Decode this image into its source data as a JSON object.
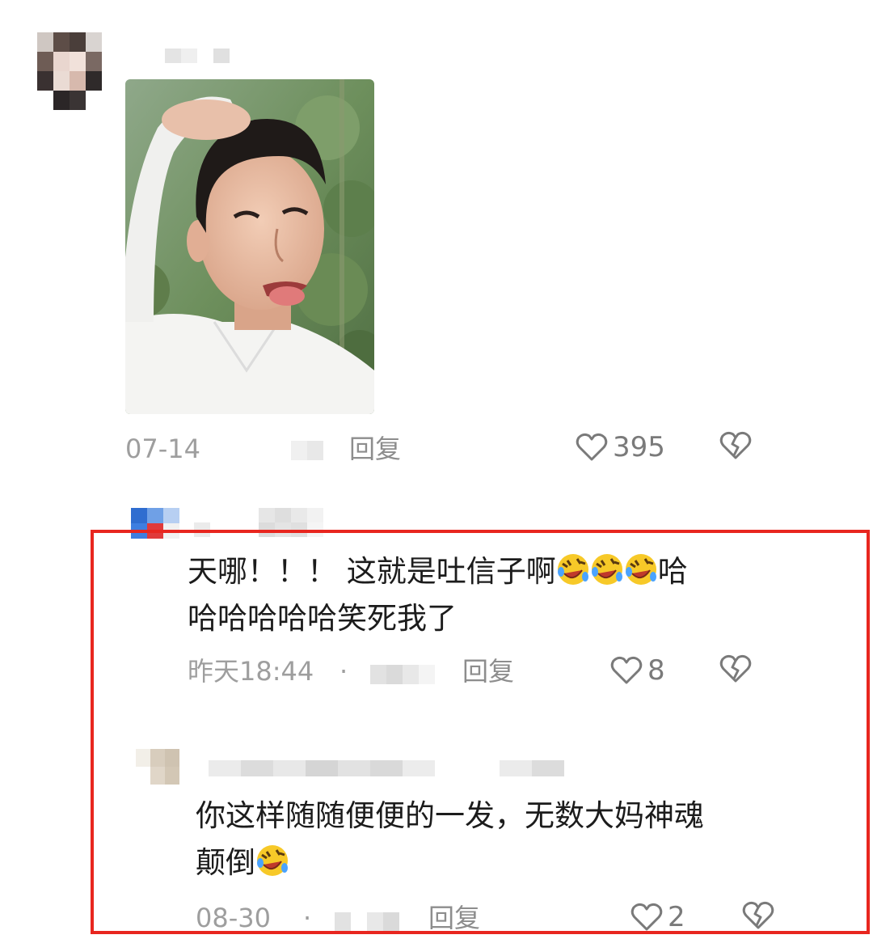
{
  "comments": [
    {
      "date": "07-14",
      "reply_label": "回复",
      "likes": "395",
      "has_image": true
    },
    {
      "text_line1": "天哪！！！ 这就是吐信子啊",
      "text_line1_tail": "哈",
      "text_line2": "哈哈哈哈哈笑死我了",
      "emoji_count_line1": 3,
      "date": "昨天18:44",
      "separator": "·",
      "reply_label": "回复",
      "likes": "8"
    },
    {
      "text_line1": "你这样随随便便的一发，无数大妈神魂",
      "text_line2": "颠倒",
      "date": "08-30",
      "separator": "·",
      "reply_label": "回复",
      "likes": "2"
    }
  ],
  "icons": {
    "like": "heart-outline-icon",
    "dislike": "broken-heart-icon",
    "emoji": "rolling-on-floor-laughing-emoji"
  },
  "colors": {
    "highlight_border": "#e8261f",
    "text": "#1c1c1c",
    "meta": "#9e9e9e"
  }
}
